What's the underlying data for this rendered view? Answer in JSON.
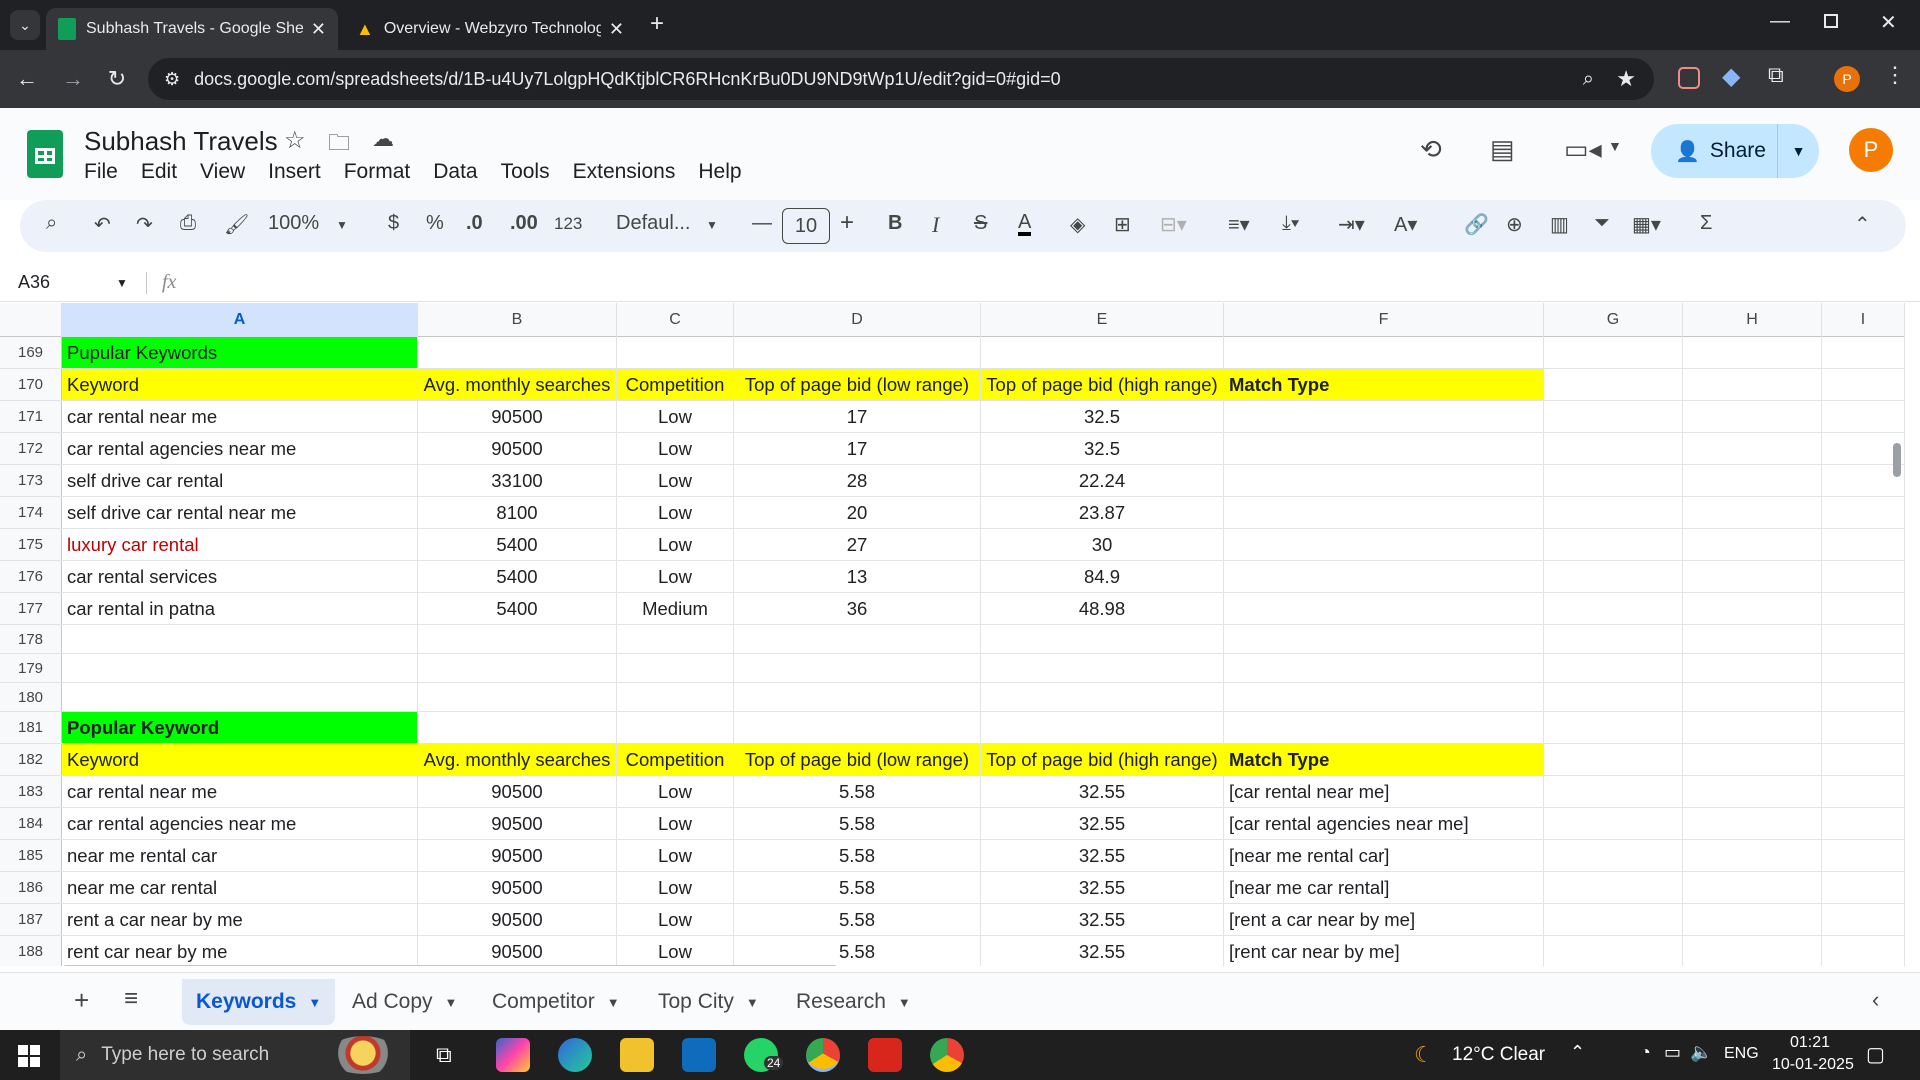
{
  "browser": {
    "tabs": [
      {
        "title": "Subhash Travels - Google Sheets",
        "active": true
      },
      {
        "title": "Overview - Webzyro Technologies",
        "active": false
      }
    ],
    "url": "docs.google.com/spreadsheets/d/1B-u4Uy7LolgpHQdKtjblCR6RHcnKrBu0DU9ND9tWp1U/edit?gid=0#gid=0",
    "profile_initial": "P"
  },
  "sheets": {
    "doc_title": "Subhash Travels",
    "menu": [
      "File",
      "Edit",
      "View",
      "Insert",
      "Format",
      "Data",
      "Tools",
      "Extensions",
      "Help"
    ],
    "share_label": "Share",
    "avatar_initial": "P",
    "toolbar": {
      "zoom": "100%",
      "currency": "$",
      "percent": "%",
      "dec_less": ".0",
      "dec_more": ".00",
      "number_format": "123",
      "font": "Defaul...",
      "font_size": "10",
      "bold": "B",
      "italic": "I",
      "strike": "S",
      "text_color": "A"
    },
    "name_box": "A36",
    "fx": "fx",
    "columns": [
      "A",
      "B",
      "C",
      "D",
      "E",
      "F",
      "G",
      "H",
      "I"
    ],
    "rows": [
      {
        "num": "169",
        "style": "title-green",
        "cells": [
          "Pupular Keywords",
          "",
          "",
          "",
          "",
          ""
        ]
      },
      {
        "num": "170",
        "style": "header-yellow",
        "cells": [
          "Keyword",
          "Avg. monthly searches",
          "Competition",
          "Top of page bid (low range)",
          "Top of page bid (high range)",
          "Match Type"
        ]
      },
      {
        "num": "171",
        "style": "",
        "cells": [
          "car rental near me",
          "90500",
          "Low",
          "17",
          "32.5",
          ""
        ]
      },
      {
        "num": "172",
        "style": "",
        "cells": [
          "car rental agencies near me",
          "90500",
          "Low",
          "17",
          "32.5",
          ""
        ]
      },
      {
        "num": "173",
        "style": "",
        "cells": [
          "self drive car rental",
          "33100",
          "Low",
          "28",
          "22.24",
          ""
        ]
      },
      {
        "num": "174",
        "style": "",
        "cells": [
          "self drive car rental near me",
          "8100",
          "Low",
          "20",
          "23.87",
          ""
        ]
      },
      {
        "num": "175",
        "style": "red-keyword",
        "cells": [
          "luxury car rental",
          "5400",
          "Low",
          "27",
          "30",
          ""
        ]
      },
      {
        "num": "176",
        "style": "",
        "cells": [
          "car rental services",
          "5400",
          "Low",
          "13",
          "84.9",
          ""
        ]
      },
      {
        "num": "177",
        "style": "",
        "cells": [
          "car rental in patna",
          "5400",
          "Medium",
          "36",
          "48.98",
          ""
        ]
      },
      {
        "num": "178",
        "style": "",
        "cells": [
          "",
          "",
          "",
          "",
          "",
          ""
        ]
      },
      {
        "num": "179",
        "style": "",
        "cells": [
          "",
          "",
          "",
          "",
          "",
          ""
        ]
      },
      {
        "num": "180",
        "style": "",
        "cells": [
          "",
          "",
          "",
          "",
          "",
          ""
        ]
      },
      {
        "num": "181",
        "style": "title-green-bold",
        "cells": [
          "Popular Keyword",
          "",
          "",
          "",
          "",
          ""
        ]
      },
      {
        "num": "182",
        "style": "header-yellow",
        "cells": [
          "Keyword",
          "Avg. monthly searches",
          "Competition",
          "Top of page bid (low range)",
          "Top of page bid (high range)",
          "Match Type"
        ]
      },
      {
        "num": "183",
        "style": "",
        "cells": [
          "car rental near me",
          "90500",
          "Low",
          "5.58",
          "32.55",
          "[car rental near me]"
        ]
      },
      {
        "num": "184",
        "style": "",
        "cells": [
          "car rental agencies near me",
          "90500",
          "Low",
          "5.58",
          "32.55",
          "[car rental agencies near me]"
        ]
      },
      {
        "num": "185",
        "style": "",
        "cells": [
          "near me rental car",
          "90500",
          "Low",
          "5.58",
          "32.55",
          "[near me rental car]"
        ]
      },
      {
        "num": "186",
        "style": "",
        "cells": [
          "near me car rental",
          "90500",
          "Low",
          "5.58",
          "32.55",
          "[near me car rental]"
        ]
      },
      {
        "num": "187",
        "style": "",
        "cells": [
          "rent a car near by me",
          "90500",
          "Low",
          "5.58",
          "32.55",
          "[rent a car near by me]"
        ]
      },
      {
        "num": "188",
        "style": "",
        "cells": [
          "rent car near by me",
          "90500",
          "Low",
          "5.58",
          "32.55",
          "[rent car near by me]"
        ]
      }
    ],
    "sheet_tabs": [
      {
        "label": "Keywords",
        "active": true
      },
      {
        "label": "Ad Copy",
        "active": false
      },
      {
        "label": "Competitor",
        "active": false
      },
      {
        "label": "Top City",
        "active": false
      },
      {
        "label": "Research",
        "active": false
      }
    ]
  },
  "taskbar": {
    "search_placeholder": "Type here to search",
    "weather": "12°C Clear",
    "lang": "ENG",
    "time": "01:21",
    "date": "10-01-2025",
    "whatsapp_badge": "24"
  },
  "colors": {
    "green_fill": "#00ff00",
    "yellow_fill": "#ffff00",
    "red_text": "#c00000",
    "share_bg": "#c2e7ff",
    "active_tab": "#0b57d0"
  }
}
